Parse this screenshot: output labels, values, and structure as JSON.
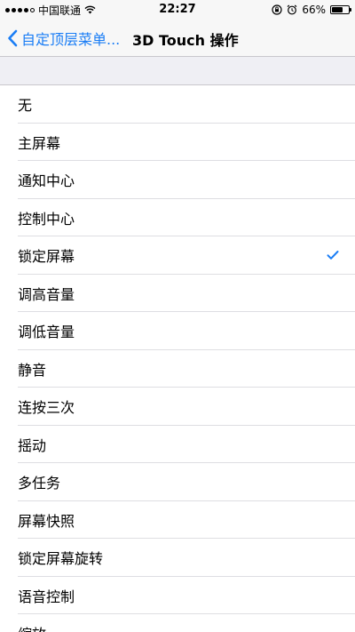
{
  "status_bar": {
    "carrier": "中国联通",
    "time": "22:27",
    "battery_text": "66%",
    "battery_level": 0.66,
    "icons": [
      "signal-dots",
      "wifi-icon",
      "orientation-lock-icon",
      "alarm-icon",
      "battery-icon"
    ]
  },
  "nav": {
    "back_label": "自定顶层菜单...",
    "title": "3D Touch 操作"
  },
  "accent_color": "#1a7df5",
  "list": {
    "items": [
      {
        "label": "无",
        "selected": false
      },
      {
        "label": "主屏幕",
        "selected": false
      },
      {
        "label": "通知中心",
        "selected": false
      },
      {
        "label": "控制中心",
        "selected": false
      },
      {
        "label": "锁定屏幕",
        "selected": true
      },
      {
        "label": "调高音量",
        "selected": false
      },
      {
        "label": "调低音量",
        "selected": false
      },
      {
        "label": "静音",
        "selected": false
      },
      {
        "label": "连按三次",
        "selected": false
      },
      {
        "label": "摇动",
        "selected": false
      },
      {
        "label": "多任务",
        "selected": false
      },
      {
        "label": "屏幕快照",
        "selected": false
      },
      {
        "label": "锁定屏幕旋转",
        "selected": false
      },
      {
        "label": "语音控制",
        "selected": false
      },
      {
        "label": "缩放",
        "selected": false
      }
    ]
  }
}
